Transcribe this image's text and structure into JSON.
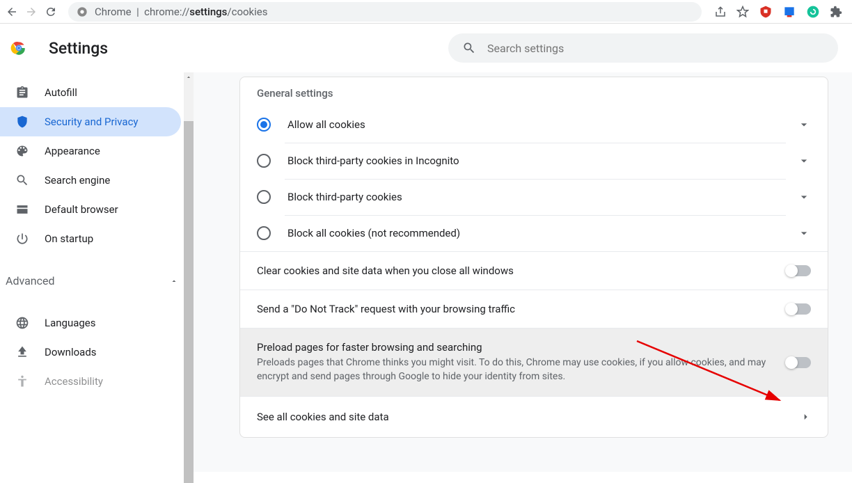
{
  "browser": {
    "url_prefix": "Chrome",
    "url_path_pre": "chrome://",
    "url_path_bold": "settings",
    "url_path_post": "/cookies"
  },
  "header": {
    "title": "Settings"
  },
  "search": {
    "placeholder": "Search settings"
  },
  "sidebar": {
    "items": [
      {
        "label": "Autofill"
      },
      {
        "label": "Security and Privacy"
      },
      {
        "label": "Appearance"
      },
      {
        "label": "Search engine"
      },
      {
        "label": "Default browser"
      },
      {
        "label": "On startup"
      }
    ],
    "advanced": "Advanced",
    "adv_items": [
      {
        "label": "Languages"
      },
      {
        "label": "Downloads"
      },
      {
        "label": "Accessibility"
      }
    ]
  },
  "main": {
    "group_title": "General settings",
    "radios": [
      {
        "label": "Allow all cookies",
        "selected": true
      },
      {
        "label": "Block third-party cookies in Incognito",
        "selected": false
      },
      {
        "label": "Block third-party cookies",
        "selected": false
      },
      {
        "label": "Block all cookies (not recommended)",
        "selected": false
      }
    ],
    "toggles": [
      {
        "title": "Clear cookies and site data when you close all windows",
        "desc": "",
        "on": false
      },
      {
        "title": "Send a \"Do Not Track\" request with your browsing traffic",
        "desc": "",
        "on": false
      },
      {
        "title": "Preload pages for faster browsing and searching",
        "desc": "Preloads pages that Chrome thinks you might visit. To do this, Chrome may use cookies, if you allow cookies, and may encrypt and send pages through Google to hide your identity from sites.",
        "on": false,
        "highlight": true
      }
    ],
    "link": {
      "label": "See all cookies and site data"
    }
  }
}
